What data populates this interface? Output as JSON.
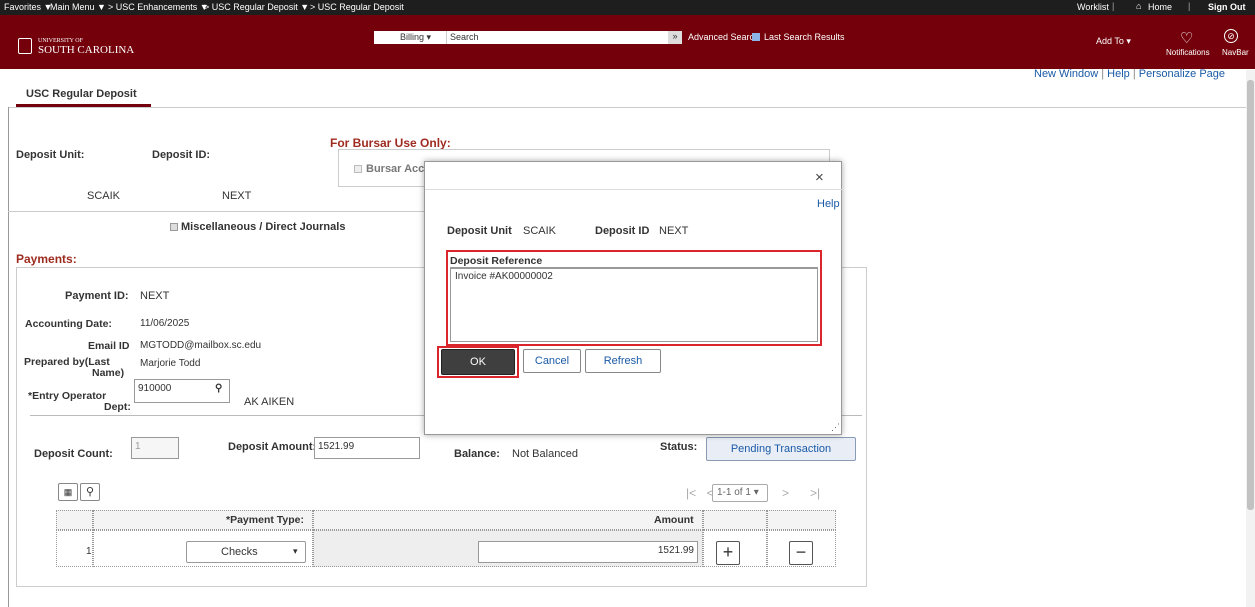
{
  "topbar": {
    "favorites": "Favorites ▼",
    "main_menu": "Main Menu ▼",
    "crumb1": "> USC Enhancements ▼",
    "crumb2": "> USC Regular Deposit ▼",
    "crumb3": "> USC Regular Deposit",
    "worklist": "Worklist",
    "home": "Home",
    "signout": "Sign Out"
  },
  "header": {
    "university_small": "UNIVERSITY OF",
    "university_big": "SOUTH CAROLINA",
    "search_category": "Billing",
    "search_placeholder": "Search",
    "advanced_search": "Advanced Search",
    "last_search": "Last Search Results",
    "add_to": "Add To",
    "notifications": "Notifications",
    "navbar": "NavBar"
  },
  "links": {
    "new_window": "New Window",
    "help": "Help",
    "personalize": "Personalize Page"
  },
  "page": {
    "tab_title": "USC Regular Deposit",
    "bursar_title": "For Bursar Use Only:",
    "bursar_cb": "Bursar Acc",
    "deposit_unit_label": "Deposit Unit:",
    "deposit_id_label": "Deposit ID:",
    "deposit_unit": "SCAIK",
    "deposit_id": "NEXT",
    "misc_label": "Miscellaneous / Direct Journals",
    "payments_title": "Payments:",
    "payment_id_label": "Payment ID:",
    "payment_id": "NEXT",
    "acct_date_label": "Accounting Date:",
    "acct_date": "11/06/2025",
    "email_label": "Email ID",
    "email": "MGTODD@mailbox.sc.edu",
    "prepared_label1": "Prepared by(Last",
    "prepared_label2": "Name)",
    "prepared": "Marjorie Todd",
    "entry_label1": "*Entry Operator",
    "entry_label2": "Dept:",
    "entry_value": "910000",
    "entry_desc": "AK AIKEN",
    "deposit_count_label": "Deposit Count:",
    "deposit_count": "1",
    "deposit_amount_label": "Deposit Amount:",
    "deposit_amount": "1521.99",
    "balance_label": "Balance:",
    "balance": "Not Balanced",
    "status_label": "Status:",
    "status": "Pending Transaction",
    "pager": "1-1 of 1",
    "col_payment_type": "*Payment Type:",
    "col_amount": "Amount",
    "row_num": "1",
    "row_type": "Checks",
    "row_amount": "1521.99"
  },
  "modal": {
    "close": "×",
    "help": "Help",
    "deposit_unit_label": "Deposit Unit",
    "deposit_unit": "SCAIK",
    "deposit_id_label": "Deposit ID",
    "deposit_id": "NEXT",
    "ref_label": "Deposit Reference",
    "ref_value": "Invoice #AK00000002",
    "ok": "OK",
    "cancel": "Cancel",
    "refresh": "Refresh"
  },
  "colors": {
    "brand": "#73000a",
    "link": "#1a5aa6",
    "title": "#9e2b1f",
    "highlight": "#d9262c"
  }
}
